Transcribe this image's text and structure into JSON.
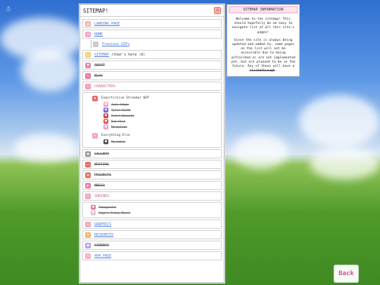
{
  "sitemap": {
    "title": "SITEMAP!",
    "home_link": "HOME",
    "previous_gifs": "Previous GIFs",
    "sitemap_link": "SITEMAP",
    "sitemap_note": "(that's here :D)",
    "landing_page": "LANDING PAGE",
    "about": "ABOUT",
    "blog": "BLOG",
    "characters": {
      "label": "CHARACTERS",
      "groups": [
        {
          "title": "Esports/Live Streamer WIP",
          "items": [
            "Jude Adams",
            "Tyler Smith",
            "Aster Bianchi",
            "Bea Hiro",
            "Marmalade"
          ]
        },
        {
          "title": "Everything Else",
          "items": [
            "Mirothin"
          ]
        }
      ]
    },
    "gallery": "GALLERY",
    "writing": "WRITING",
    "projects": "PROJECTS",
    "media": "MEDIA",
    "shrines": {
      "label": "SHRINES",
      "items": [
        "Tamagotchi",
        "Gogo's Crazy Bones"
      ]
    },
    "graphics": "GRAPHICS",
    "resources": "RESOURCES",
    "sandbox": "SANDBOX",
    "page_404": "404 PAGE"
  },
  "info": {
    "title": "SITEMAP INFORMATION",
    "paragraph1": "Welcome to the sitemap! This should hopefully be an easy to navigate list of all this site's pages!",
    "paragraph2_pre": "Since the site is always being updated and added to, some pages on the list will not be accessible due to being unfinished or are not implemented yet, but are planned to be in the future. Any of these will have a ",
    "paragraph2_strike": "strikethrough",
    "paragraph2_post": "."
  },
  "back_button": {
    "label": "Back"
  },
  "colors": {
    "link_blue": "#4a78d8",
    "pink": "#d74f9b",
    "panel_border": "#b9b9b9"
  }
}
